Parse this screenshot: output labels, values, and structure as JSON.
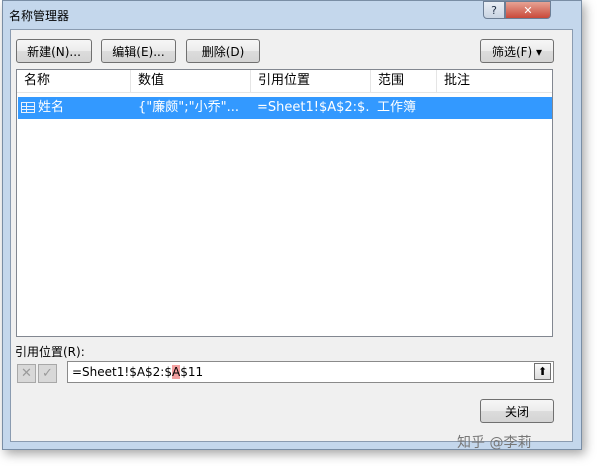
{
  "window": {
    "title": "名称管理器",
    "help_label": "?",
    "close_label": "✕"
  },
  "toolbar": {
    "new_label": "新建(N)...",
    "edit_label": "编辑(E)...",
    "delete_label": "删除(D)",
    "filter_label": "筛选(F) ▾"
  },
  "list": {
    "columns": [
      "名称",
      "数值",
      "引用位置",
      "范围",
      "批注"
    ],
    "rows": [
      {
        "name": "姓名",
        "value": "{\"廉颇\";\"小乔\"...",
        "refers_to": "=Sheet1!$A$2:$...",
        "scope": "工作簿",
        "comment": ""
      }
    ]
  },
  "refers_to": {
    "label": "引用位置(R):",
    "value_prefix": "=Sheet1!$A$2:$",
    "value_highlight": "A",
    "value_suffix": "$11",
    "cancel_icon": "x-icon",
    "confirm_icon": "check-icon"
  },
  "footer": {
    "close_label": "关闭"
  },
  "watermark": "知乎 @李莉"
}
